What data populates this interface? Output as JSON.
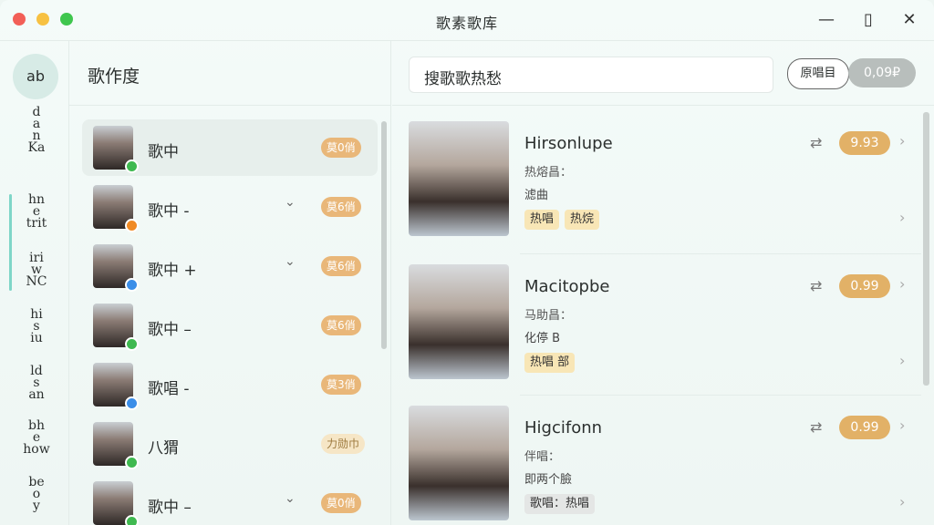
{
  "window": {
    "title": "歌素歌库"
  },
  "rail": {
    "avatar": "ab",
    "groups": [
      [
        "d",
        "a",
        "n",
        "Ka"
      ],
      [
        "hn",
        "e",
        "trit"
      ],
      [
        "iri",
        "w",
        "NC"
      ],
      [
        "hi",
        "s",
        "iu"
      ],
      [
        "ld",
        "s",
        "an"
      ],
      [
        "bh",
        "e",
        "how"
      ],
      [
        "be",
        "o",
        "y"
      ]
    ]
  },
  "list": {
    "title": "歌作度",
    "items": [
      {
        "name": "歌中",
        "chevron": "",
        "badge": "莫0俏",
        "status": "#3fb950",
        "selected": true,
        "light": false
      },
      {
        "name": "歌中 -",
        "chevron": "⌄",
        "badge": "莫6俏",
        "status": "#f08a24",
        "selected": false,
        "light": false
      },
      {
        "name": "歌中 +",
        "chevron": "⌄",
        "badge": "莫6俏",
        "status": "#3b8ee8",
        "selected": false,
        "light": false
      },
      {
        "name": "歌中 –",
        "chevron": "",
        "badge": "莫6俏",
        "status": "#3fb950",
        "selected": false,
        "light": false
      },
      {
        "name": "歌唱 -",
        "chevron": "",
        "badge": "莫3俏",
        "status": "#3b8ee8",
        "selected": false,
        "light": false
      },
      {
        "name": "八猬",
        "chevron": "",
        "badge": "力勋巾",
        "status": "#3fb950",
        "selected": false,
        "light": true
      },
      {
        "name": "歌中 –",
        "chevron": "⌄",
        "badge": "莫0俏",
        "status": "#3fb950",
        "selected": false,
        "light": false
      }
    ]
  },
  "main": {
    "search_text": "搜歌歌热愁",
    "seg_a": "原唱目",
    "seg_b": "0,09₽",
    "cards": [
      {
        "title": "Hirsonlupe",
        "line1": "热熔昌：",
        "line2": "滤曲",
        "tags": [
          "热唱",
          "热烷"
        ],
        "price": "9.93",
        "gray": false
      },
      {
        "title": "Macitopbe",
        "line1": "马助昌：",
        "line2": "化停 B",
        "tags": [
          "热唱 部"
        ],
        "price": "0.99",
        "gray": false
      },
      {
        "title": "Higcifonn",
        "line1": "伴唱：",
        "line2": "即两个臉",
        "tags": [
          "歌唱：热唱"
        ],
        "price": "0.99",
        "gray": true
      }
    ]
  }
}
